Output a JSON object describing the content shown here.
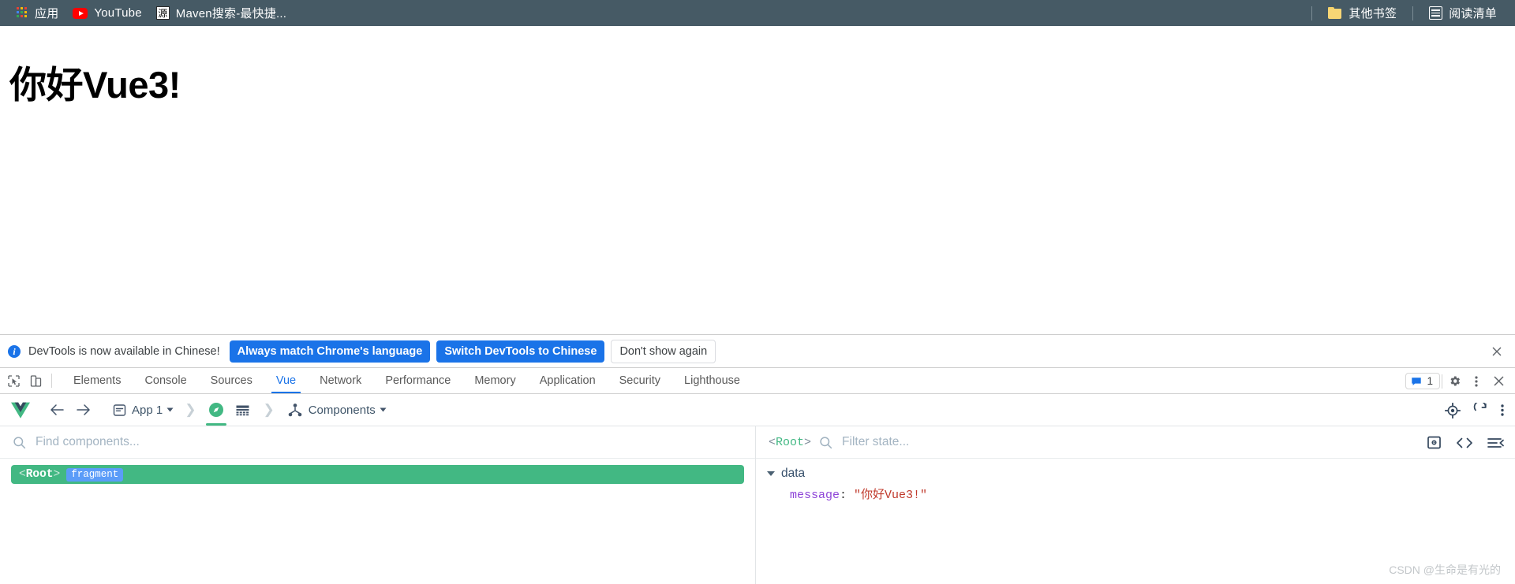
{
  "bookmarks_bar": {
    "apps_label": "应用",
    "apps_icon": "apps-grid-icon",
    "items": [
      {
        "label": "YouTube",
        "icon": "youtube-icon"
      },
      {
        "label": "Maven搜索-最快捷...",
        "icon": "maven-favicon",
        "favicon_text": "源"
      }
    ],
    "other_bookmarks_label": "其他书签",
    "other_bookmarks_icon": "folder-icon",
    "reading_list_label": "阅读清单",
    "reading_list_icon": "reading-list-icon",
    "background_color": "#465a65"
  },
  "page": {
    "heading": "你好Vue3!"
  },
  "devtools_notice": {
    "info_icon": "info-icon",
    "message": "DevTools is now available in Chinese!",
    "primary_button": "Always match Chrome's language",
    "secondary_button": "Switch DevTools to Chinese",
    "dismiss_button": "Don't show again",
    "close_icon": "close-icon",
    "accent_color": "#1a73e8"
  },
  "devtools_tabbar": {
    "inspect_icon": "inspect-element-icon",
    "device_icon": "device-toolbar-icon",
    "tabs": [
      {
        "label": "Elements",
        "active": false
      },
      {
        "label": "Console",
        "active": false
      },
      {
        "label": "Sources",
        "active": false
      },
      {
        "label": "Vue",
        "active": true
      },
      {
        "label": "Network",
        "active": false
      },
      {
        "label": "Performance",
        "active": false
      },
      {
        "label": "Memory",
        "active": false
      },
      {
        "label": "Application",
        "active": false
      },
      {
        "label": "Security",
        "active": false
      },
      {
        "label": "Lighthouse",
        "active": false
      }
    ],
    "issues_icon": "issues-message-icon",
    "issues_count": "1",
    "settings_icon": "gear-icon",
    "more_icon": "kebab-menu-icon",
    "close_icon": "close-icon",
    "active_color": "#1a73e8"
  },
  "vue_toolbar": {
    "logo_icon": "vue-logo-icon",
    "back_icon": "arrow-left-icon",
    "forward_icon": "arrow-right-icon",
    "app_selector": {
      "icon": "app-document-icon",
      "label": "App 1",
      "chevron_icon": "chevron-down-icon"
    },
    "route_icon": "compass-icon",
    "route_icon_active": true,
    "grid_icon": "grid-rows-icon",
    "view_selector": {
      "icon": "components-tree-icon",
      "label": "Components",
      "chevron_icon": "chevron-down-icon"
    },
    "select_target_icon": "target-crosshair-icon",
    "refresh_icon": "refresh-icon",
    "more_icon": "kebab-menu-icon",
    "accent_color": "#42b883"
  },
  "component_tree": {
    "search": {
      "icon": "search-icon",
      "placeholder": "Find components...",
      "value": ""
    },
    "nodes": [
      {
        "open_bracket": "<",
        "name": "Root",
        "close_bracket": ">",
        "badge": "fragment",
        "selected": true
      }
    ]
  },
  "state_panel": {
    "component_open_bracket": "<",
    "component_name": "Root",
    "component_close_bracket": ">",
    "search": {
      "icon": "search-icon",
      "placeholder": "Filter state...",
      "value": ""
    },
    "toggle_preview_icon": "inspect-preview-icon",
    "view_source_icon": "code-brackets-icon",
    "collapse_icon": "collapse-all-icon",
    "groups": [
      {
        "name": "data",
        "expanded": true,
        "properties": [
          {
            "key": "message",
            "separator": ":",
            "value": "\"你好Vue3!\""
          }
        ]
      }
    ]
  },
  "watermark": {
    "text": "CSDN @生命是有光的"
  }
}
